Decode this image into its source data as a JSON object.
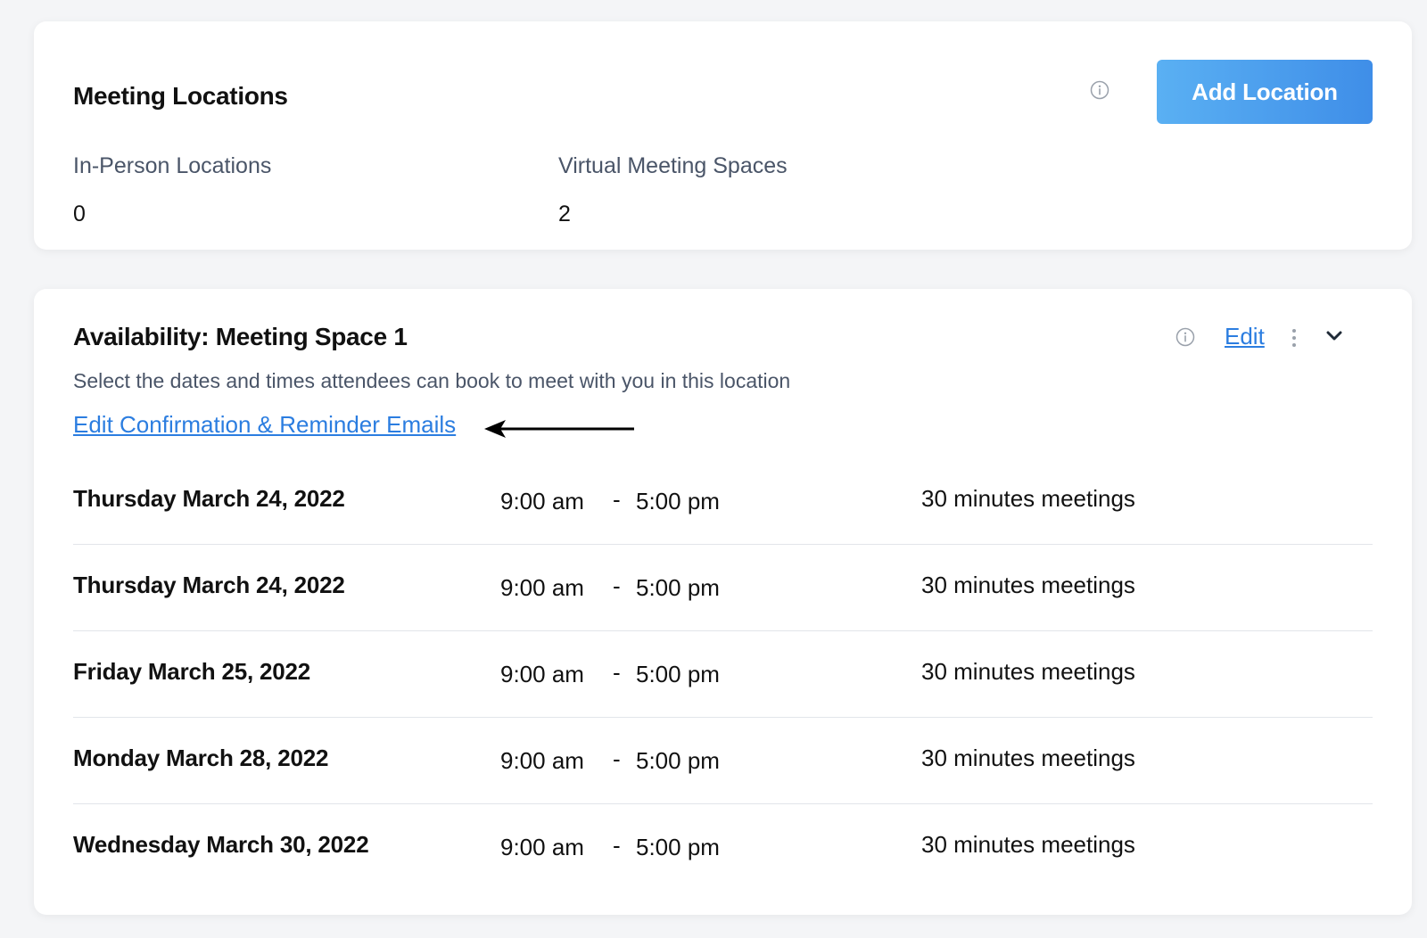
{
  "locations": {
    "title": "Meeting Locations",
    "in_person_label": "In-Person Locations",
    "in_person_count": "0",
    "virtual_label": "Virtual Meeting Spaces",
    "virtual_count": "2",
    "add_button_label": "Add Location"
  },
  "availability": {
    "title": "Availability: Meeting Space 1",
    "subtitle": "Select the dates and times attendees can book to meet with you in this location",
    "emails_link": "Edit Confirmation & Reminder Emails",
    "edit_label": "Edit",
    "rows": [
      {
        "date": "Thursday March 24, 2022",
        "start": "9:00 am",
        "dash": "-",
        "end": "5:00 pm",
        "duration": "30 minutes meetings"
      },
      {
        "date": "Thursday March 24, 2022",
        "start": "9:00 am",
        "dash": "-",
        "end": "5:00 pm",
        "duration": "30 minutes meetings"
      },
      {
        "date": "Friday March 25, 2022",
        "start": "9:00 am",
        "dash": "-",
        "end": "5:00 pm",
        "duration": "30 minutes meetings"
      },
      {
        "date": "Monday March 28, 2022",
        "start": "9:00 am",
        "dash": "-",
        "end": "5:00 pm",
        "duration": "30 minutes meetings"
      },
      {
        "date": "Wednesday March 30, 2022",
        "start": "9:00 am",
        "dash": "-",
        "end": "5:00 pm",
        "duration": "30 minutes meetings"
      }
    ]
  },
  "icons": {
    "info": "info-circle-icon",
    "kebab": "more-vertical-icon",
    "chevron": "chevron-down-icon",
    "arrow": "arrow-left-icon"
  },
  "colors": {
    "accent": "#2b7de0",
    "button_start": "#5ab0f3",
    "button_end": "#3f8ee8",
    "muted_text": "#4a5568",
    "divider": "#e2e5ea",
    "background": "#f4f5f7"
  }
}
